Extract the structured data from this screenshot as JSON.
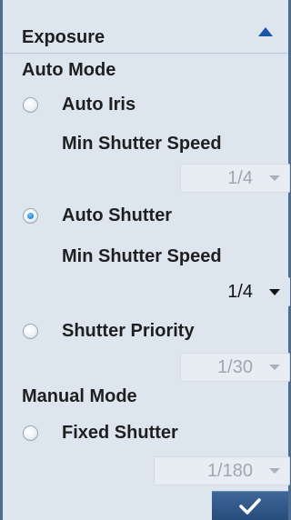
{
  "panel": {
    "title": "Exposure",
    "auto_mode_label": "Auto Mode",
    "manual_mode_label": "Manual Mode",
    "options": [
      {
        "label": "Auto Iris",
        "selected": false,
        "sub_label": "Min Shutter Speed",
        "select_value": "1/4",
        "select_enabled": false
      },
      {
        "label": "Auto Shutter",
        "selected": true,
        "sub_label": "Min Shutter Speed",
        "select_value": "1/4",
        "select_enabled": true
      },
      {
        "label": "Shutter Priority",
        "selected": false,
        "select_value": "1/30",
        "select_enabled": false
      },
      {
        "label": "Fixed Shutter",
        "selected": false,
        "select_value": "1/180",
        "select_enabled": false
      }
    ],
    "collapse_icon": "triangle-up-icon",
    "apply_icon": "checkmark-icon",
    "colors": {
      "accent": "#1a56a6",
      "panel_bg": "#dde6ef",
      "border": "#4e6c91",
      "button": "#2f5686"
    }
  }
}
